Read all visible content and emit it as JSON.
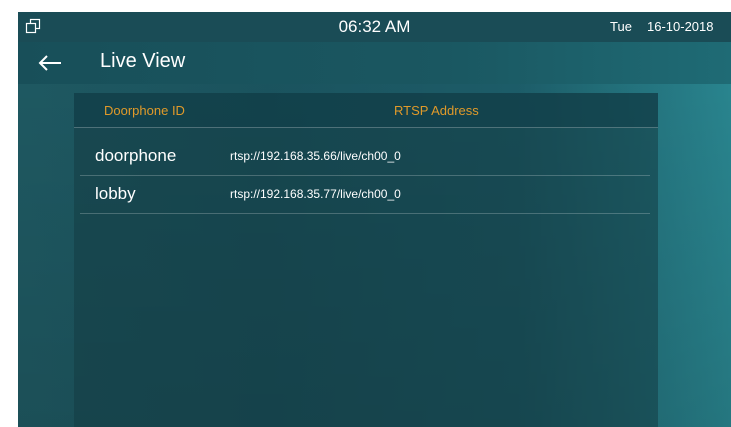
{
  "status_bar": {
    "window_icon": "window-restore-icon",
    "time": "06:32 AM",
    "day": "Tue",
    "date": "16-10-2018"
  },
  "header": {
    "back_icon": "arrow-left-icon",
    "title": "Live View"
  },
  "table": {
    "columns": [
      "Doorphone ID",
      "RTSP Address"
    ],
    "rows": [
      {
        "id": "doorphone",
        "rtsp": "rtsp://192.168.35.66/live/ch00_0"
      },
      {
        "id": "lobby",
        "rtsp": "rtsp://192.168.35.77/live/ch00_0"
      }
    ]
  },
  "colors": {
    "accent": "#e09a2a",
    "background": "#1b5560",
    "text": "#ffffff"
  }
}
